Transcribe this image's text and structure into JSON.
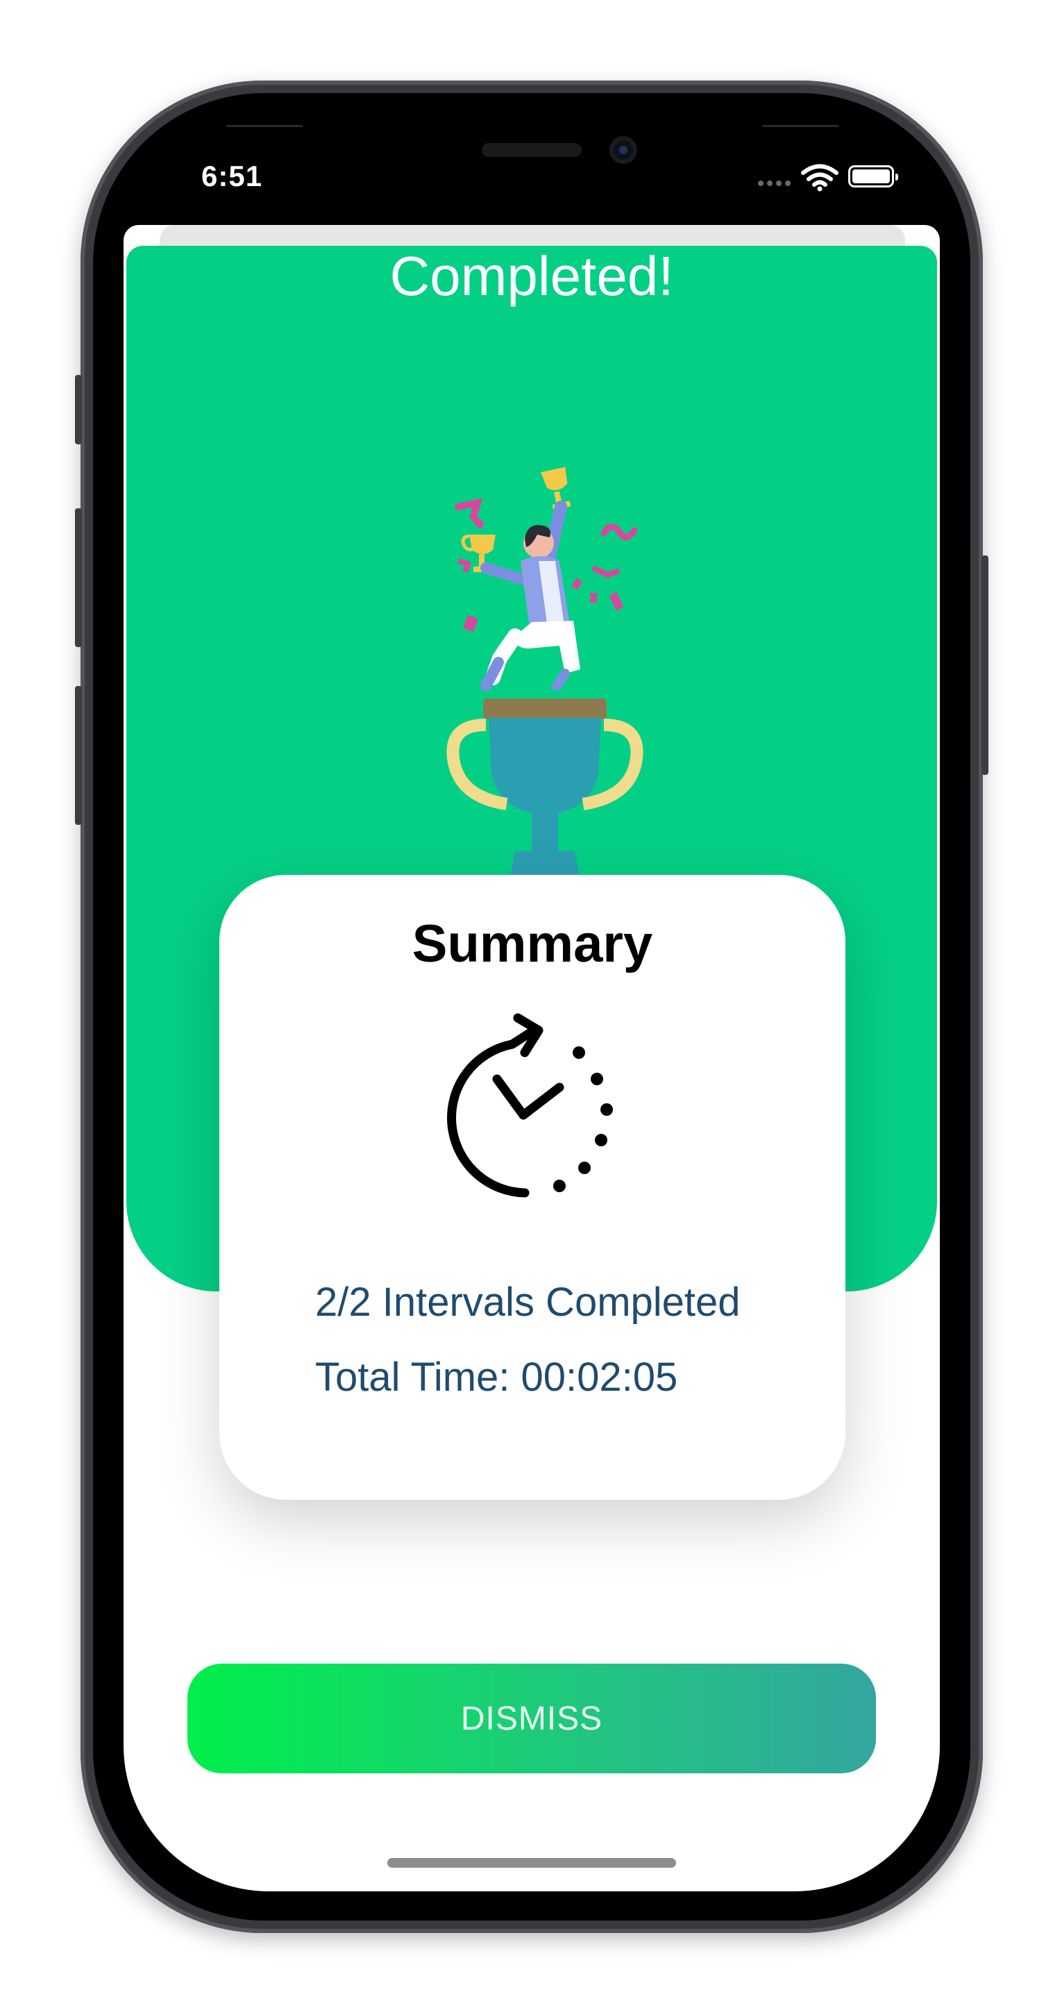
{
  "status_bar": {
    "time": "6:51"
  },
  "header": {
    "title": "Completed!"
  },
  "summary": {
    "title": "Summary",
    "intervals_text": "2/2 Intervals Completed",
    "total_time_text": "Total Time: 00:02:05"
  },
  "actions": {
    "dismiss_label": "DISMISS"
  },
  "colors": {
    "panel_green": "#04d085",
    "text_blue": "#1f4b6e",
    "button_gradient_start": "#00ef4a",
    "button_gradient_end": "#33a69f"
  },
  "icons": [
    "wifi-icon",
    "battery-icon",
    "trophy-illustration",
    "timer-icon"
  ]
}
